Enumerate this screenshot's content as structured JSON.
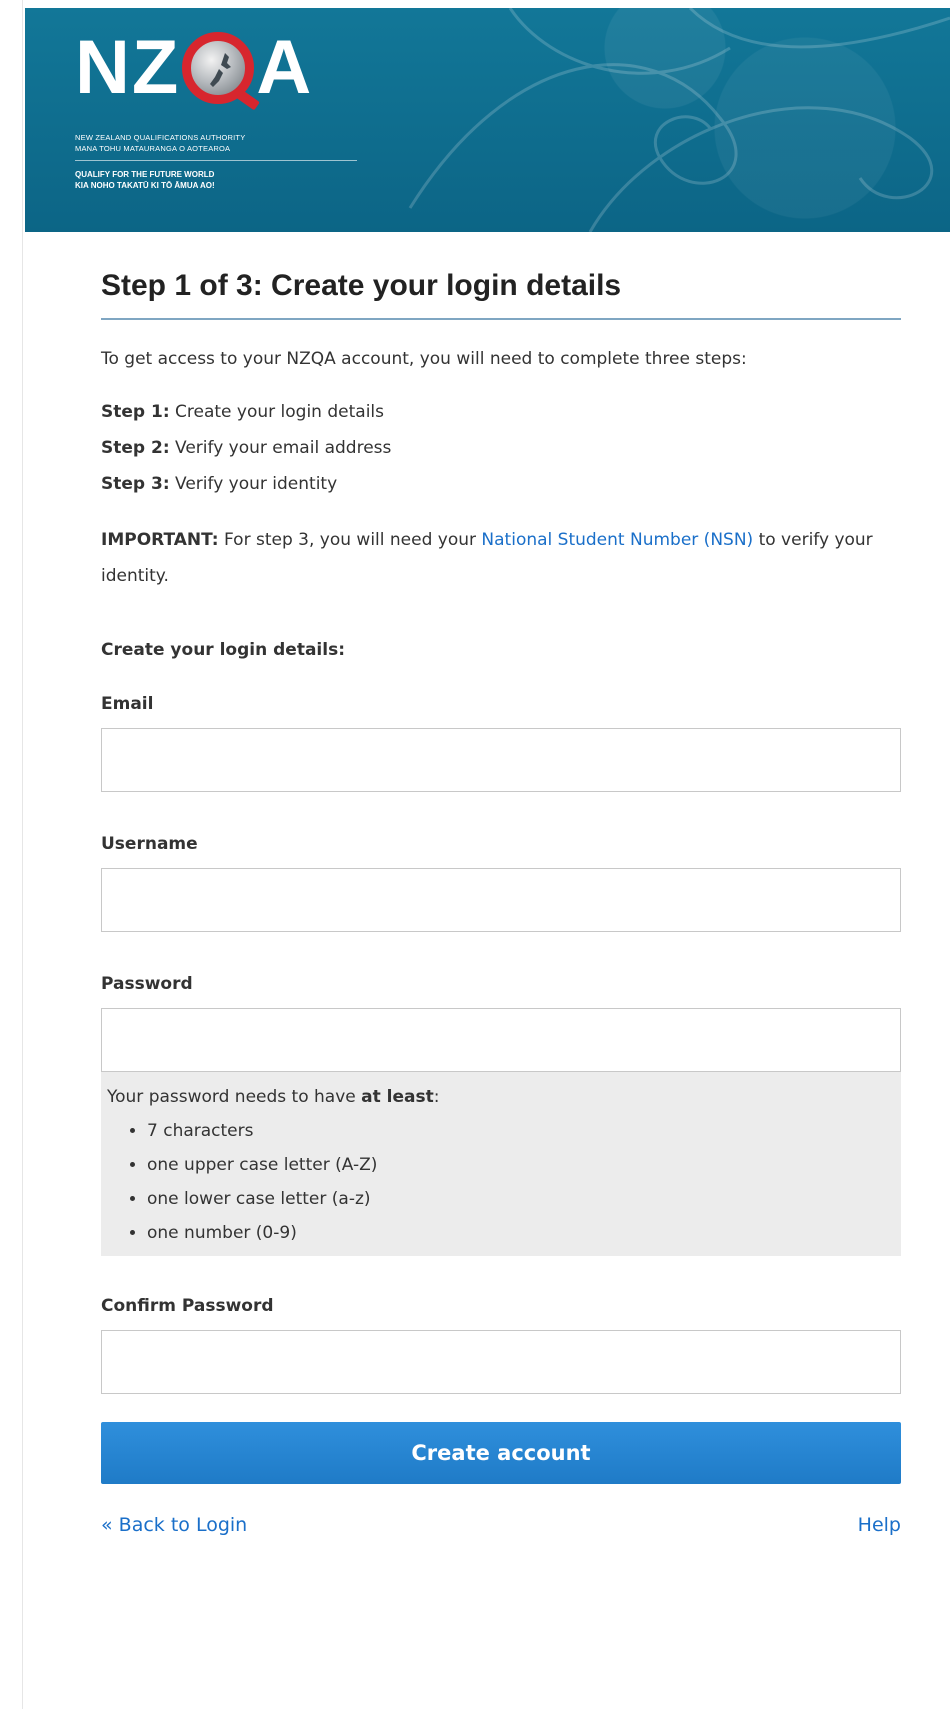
{
  "brand": {
    "colors": {
      "header": "#0f6f8f",
      "accent_red": "#d7262e",
      "link": "#1a6fc9",
      "button": "#2684d0"
    },
    "logo": {
      "wordmark_left": "NZ",
      "wordmark_right": "A",
      "subtitle_line1": "NEW ZEALAND QUALIFICATIONS AUTHORITY",
      "subtitle_line2": "MANA TOHU MATAURANGA O AOTEAROA",
      "tagline_line1": "QUALIFY FOR THE FUTURE WORLD",
      "tagline_line2": "KIA NOHO TAKATŪ KI TŌ ĀMUA AO!"
    }
  },
  "page": {
    "title_step": "Step 1 of 3:",
    "title_text": " Create your login details",
    "intro": "To get access to your NZQA account, you will need to complete three steps:",
    "steps": [
      {
        "label": "Step 1:",
        "text": " Create your login details"
      },
      {
        "label": "Step 2:",
        "text": " Verify your email address"
      },
      {
        "label": "Step 3:",
        "text": " Verify your identity"
      }
    ],
    "important_label": "IMPORTANT:",
    "important_text_before": " For step 3, you will need your ",
    "important_link": "National Student Number (NSN)",
    "important_text_after": " to verify your identity.",
    "section_label": "Create your login details:"
  },
  "form": {
    "email": {
      "label": "Email",
      "value": "",
      "placeholder": ""
    },
    "username": {
      "label": "Username",
      "value": "",
      "placeholder": ""
    },
    "password": {
      "label": "Password",
      "value": "",
      "placeholder": ""
    },
    "password_hint": {
      "prefix": "Your password needs to have ",
      "bold": "at least",
      "suffix": ":",
      "rules": [
        "7 characters",
        "one upper case letter (A-Z)",
        "one lower case letter (a-z)",
        "one number (0-9)"
      ]
    },
    "confirm_password": {
      "label": "Confirm Password",
      "value": "",
      "placeholder": ""
    },
    "submit_label": "Create account"
  },
  "footer": {
    "back_link": "« Back to Login",
    "help_link": "Help"
  }
}
